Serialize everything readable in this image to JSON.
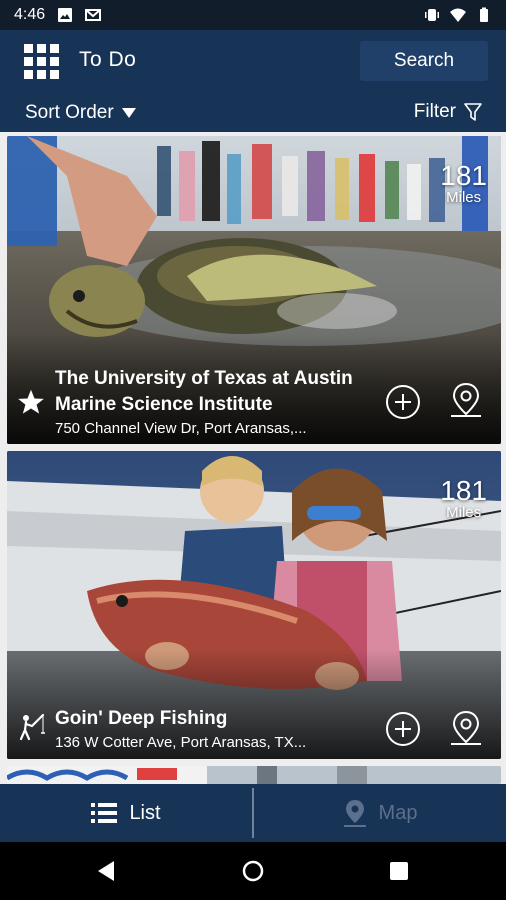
{
  "status_bar": {
    "time": "4:46"
  },
  "header": {
    "title": "To Do",
    "search_label": "Search"
  },
  "toolbar": {
    "sort_label": "Sort Order",
    "filter_label": "Filter"
  },
  "cards": [
    {
      "distance": "181",
      "distance_unit": "Miles",
      "name": "The University of Texas at Austin Marine Science Institute",
      "address": "750 Channel View Dr, Port Aransas,...",
      "category_icon": "star-icon"
    },
    {
      "distance": "181",
      "distance_unit": "Miles",
      "name": "Goin' Deep Fishing",
      "address": "136 W Cotter Ave, Port Aransas, TX...",
      "category_icon": "fishing-icon"
    }
  ],
  "bottom_nav": {
    "list_label": "List",
    "map_label": "Map"
  },
  "colors": {
    "primary": "#173356",
    "button": "#20406a",
    "status_bar": "#121d2c",
    "disabled": "#5b708c"
  }
}
